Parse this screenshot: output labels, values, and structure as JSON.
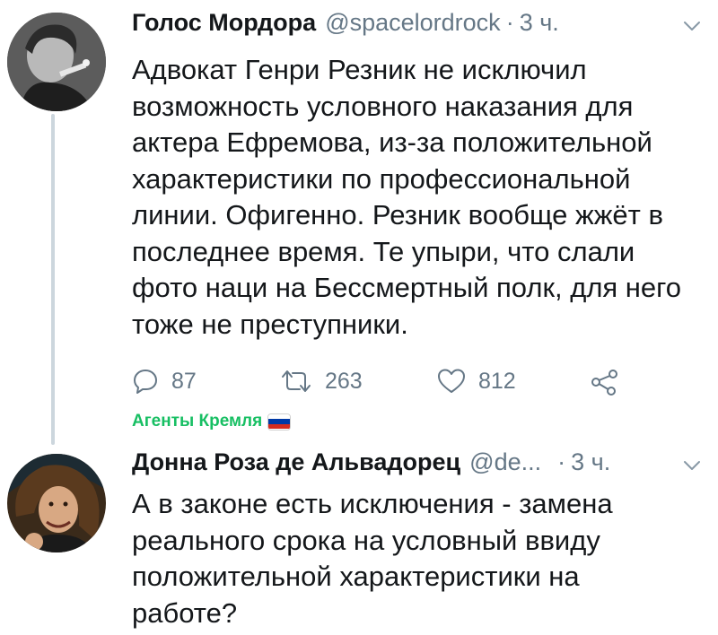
{
  "tweets": [
    {
      "author": "Голос Мордора",
      "handle": "@spacelordrock",
      "dot": "·",
      "time": "3 ч.",
      "text": "Адвокат Генри Резник не исключил\nвозможность условного наказания для\nактера Ефремова, из-за положительной\nхарактеристики по профессиональной\nлинии. Офигенно. Резник вообще жжёт в\nпоследнее время. Те упыри, что слали\nфото наци на Бессмертный полк, для него\nтоже не преступники.",
      "counts": {
        "replies": "87",
        "retweets": "263",
        "likes": "812"
      },
      "group_label": "Агенты Кремля",
      "icons": {
        "reply": "reply-icon",
        "retweet": "retweet-icon",
        "like": "heart-icon",
        "share": "share-icon",
        "menu": "chevron-down-icon",
        "flag": "russian-flag-icon"
      }
    },
    {
      "author": "Донна Роза де Альвадорец",
      "handle": "@de...",
      "dot": "·",
      "time": "3 ч.",
      "text": "А в законе есть исключения - замена\nреального срока на условный ввиду\nположительной характеристики на\nработе?"
    }
  ],
  "colors": {
    "text": "#14171a",
    "secondary": "#657786",
    "thread_line": "#ccd6dd",
    "group_green": "#17bf63"
  }
}
